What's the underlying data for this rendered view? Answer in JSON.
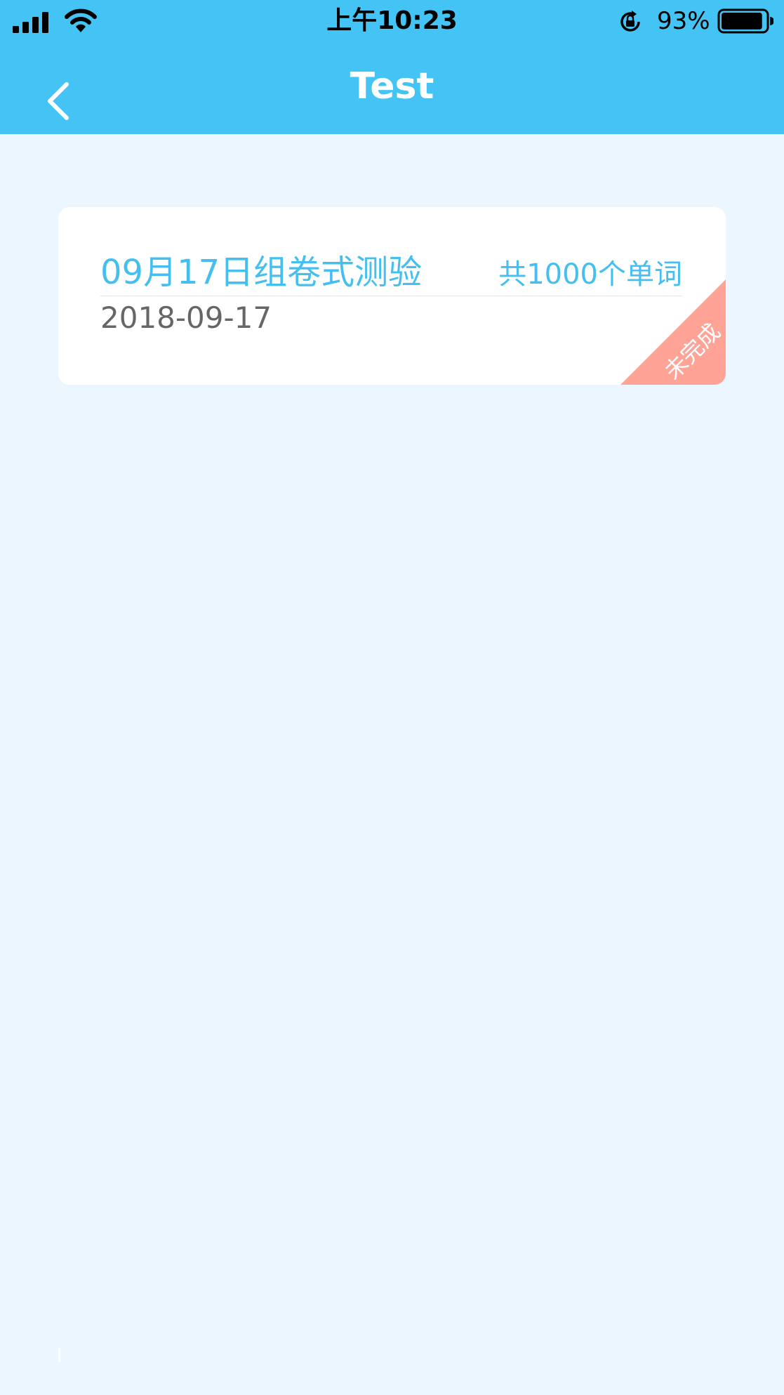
{
  "status_bar": {
    "time": "上午10:23",
    "battery_percent": "93%",
    "battery_level": 0.93
  },
  "nav": {
    "title": "Test",
    "back_icon": "chevron-left-icon"
  },
  "card": {
    "title": "09月17日组卷式测验",
    "count": "共1000个单词",
    "date": "2018-09-17",
    "status": "未完成"
  },
  "colors": {
    "header_bg": "#44c4f5",
    "page_bg": "#ebf6fe",
    "accent": "#45bff0",
    "ribbon": "#ffa397",
    "date_text": "#666666"
  }
}
